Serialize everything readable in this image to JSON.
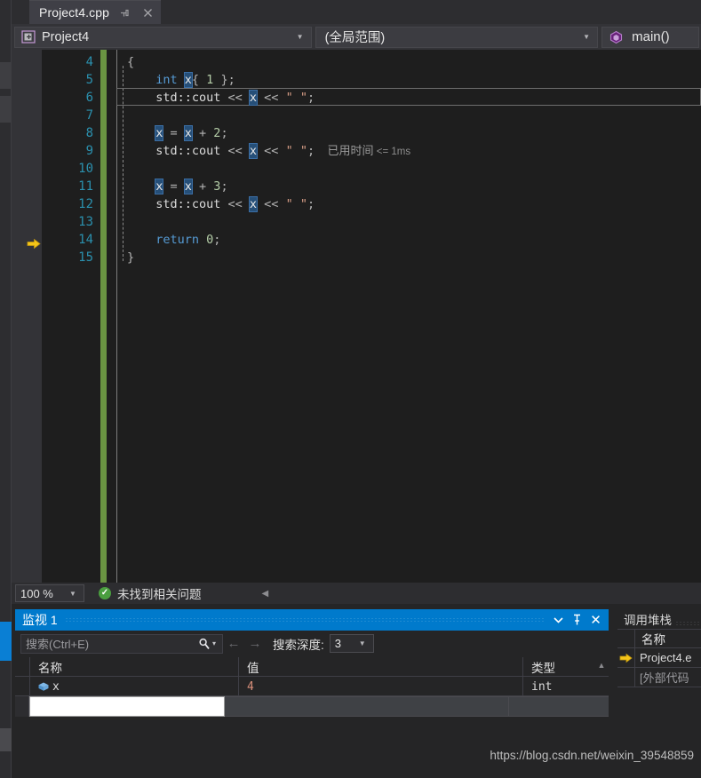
{
  "window": {
    "theme_bg": "#1e1e1e",
    "accent": "#007acc"
  },
  "tab": {
    "label": "Project4.cpp",
    "pin_icon": "pin-icon",
    "close_icon": "close-icon"
  },
  "navbar": {
    "project_icon": "project-icon",
    "project": "Project4",
    "scope": "(全局范围)",
    "member_icon": "method-icon",
    "member": "main()",
    "arrow": "▼"
  },
  "editor": {
    "first_line": 4,
    "exec_line": 9,
    "current_line": 6,
    "lines": [
      {
        "n": 4,
        "indent": 0,
        "tokens": [
          {
            "t": "{",
            "c": "pun"
          }
        ]
      },
      {
        "n": 5,
        "indent": 1,
        "tokens": [
          {
            "t": "int",
            "c": "kw"
          },
          {
            "t": " ",
            "c": "id"
          },
          {
            "t": "x",
            "c": "sel"
          },
          {
            "t": "{ ",
            "c": "pun"
          },
          {
            "t": "1",
            "c": "num"
          },
          {
            "t": " };",
            "c": "pun"
          }
        ]
      },
      {
        "n": 6,
        "indent": 1,
        "tokens": [
          {
            "t": "std::cout ",
            "c": "id"
          },
          {
            "t": "<< ",
            "c": "pun"
          },
          {
            "t": "x",
            "c": "sel"
          },
          {
            "t": " << ",
            "c": "pun"
          },
          {
            "t": "\" \"",
            "c": "str"
          },
          {
            "t": ";",
            "c": "pun"
          }
        ]
      },
      {
        "n": 7,
        "indent": 0,
        "tokens": []
      },
      {
        "n": 8,
        "indent": 1,
        "tokens": [
          {
            "t": "x",
            "c": "sel"
          },
          {
            "t": " = ",
            "c": "pun"
          },
          {
            "t": "x",
            "c": "sel"
          },
          {
            "t": " + ",
            "c": "pun"
          },
          {
            "t": "2",
            "c": "num"
          },
          {
            "t": ";",
            "c": "pun"
          }
        ]
      },
      {
        "n": 9,
        "indent": 1,
        "tokens": [
          {
            "t": "std::cout ",
            "c": "id"
          },
          {
            "t": "<< ",
            "c": "pun"
          },
          {
            "t": "x",
            "c": "sel"
          },
          {
            "t": " << ",
            "c": "pun"
          },
          {
            "t": "\" \"",
            "c": "str"
          },
          {
            "t": ";",
            "c": "pun"
          }
        ],
        "hint": "已用时间",
        "hint_small": "<= 1ms"
      },
      {
        "n": 10,
        "indent": 0,
        "tokens": []
      },
      {
        "n": 11,
        "indent": 1,
        "tokens": [
          {
            "t": "x",
            "c": "sel"
          },
          {
            "t": " = ",
            "c": "pun"
          },
          {
            "t": "x",
            "c": "sel"
          },
          {
            "t": " + ",
            "c": "pun"
          },
          {
            "t": "3",
            "c": "num"
          },
          {
            "t": ";",
            "c": "pun"
          }
        ]
      },
      {
        "n": 12,
        "indent": 1,
        "tokens": [
          {
            "t": "std::cout ",
            "c": "id"
          },
          {
            "t": "<< ",
            "c": "pun"
          },
          {
            "t": "x",
            "c": "sel"
          },
          {
            "t": " << ",
            "c": "pun"
          },
          {
            "t": "\" \"",
            "c": "str"
          },
          {
            "t": ";",
            "c": "pun"
          }
        ]
      },
      {
        "n": 13,
        "indent": 0,
        "tokens": []
      },
      {
        "n": 14,
        "indent": 1,
        "tokens": [
          {
            "t": "return",
            "c": "kw"
          },
          {
            "t": " ",
            "c": "id"
          },
          {
            "t": "0",
            "c": "num"
          },
          {
            "t": ";",
            "c": "pun"
          }
        ]
      },
      {
        "n": 15,
        "indent": 0,
        "tokens": [
          {
            "t": "}",
            "c": "pun"
          }
        ]
      }
    ]
  },
  "editor_status": {
    "zoom": "100 %",
    "zoom_arrow": "▼",
    "problems_icon": "check-circle-icon",
    "problems_text": "未找到相关问题",
    "collapse_icon": "◀"
  },
  "watch": {
    "title": "监视 1",
    "dropdown_icon": "chevron-down-icon",
    "pin_icon": "pin-icon",
    "close_icon": "✕",
    "search_placeholder": "搜索(Ctrl+E)",
    "search_icon": "search-icon",
    "search_dropdown_icon": "▾",
    "back_icon": "←",
    "forward_icon": "→",
    "depth_label": "搜索深度:",
    "depth_value": "3",
    "depth_arrow": "▼",
    "columns": [
      "名称",
      "值",
      "类型"
    ],
    "scroll_up_icon": "▲",
    "rows": [
      {
        "icon": "variable-icon",
        "name": "x",
        "value": "4",
        "type": "int"
      }
    ],
    "new_row_value": ""
  },
  "callstack": {
    "title": "调用堆栈",
    "columns": [
      "名称"
    ],
    "rows": [
      {
        "marker": "current-frame-arrow-icon",
        "name": "Project4.e"
      },
      {
        "marker": "",
        "name": "[外部代码"
      }
    ]
  },
  "watermark": "https://blog.csdn.net/weixin_39548859"
}
